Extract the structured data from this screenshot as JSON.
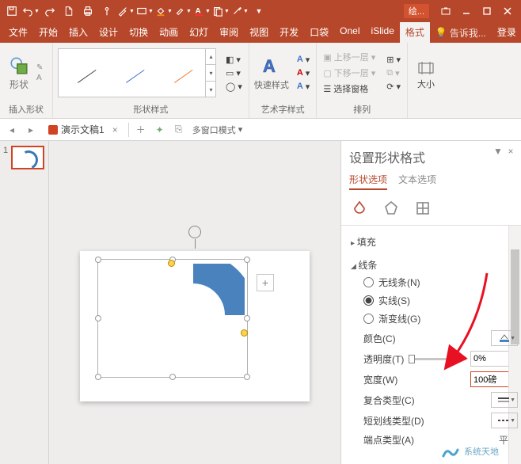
{
  "title_chip": "绘...",
  "tabs": [
    "文件",
    "开始",
    "插入",
    "设计",
    "切换",
    "动画",
    "幻灯",
    "审阅",
    "视图",
    "开发",
    "口袋",
    "Onel",
    "iSlide",
    "格式"
  ],
  "active_tab_index": 13,
  "tell_me": "告诉我...",
  "login": "登录",
  "ribbon": {
    "shapes_label": "插入形状",
    "shapes_btn": "形状",
    "styles_label": "形状样式",
    "wordart_label": "艺术字样式",
    "wordart_btn": "快速样式",
    "arrange_label": "排列",
    "bring_forward": "上移一层",
    "send_backward": "下移一层",
    "selection_pane": "选择窗格",
    "size_label": "大小"
  },
  "doc_tab": "演示文稿1",
  "multi_window": "多窗口模式",
  "thumb_number": "1",
  "plus_sign": "+",
  "pane": {
    "title": "设置形状格式",
    "tab_shape": "形状选项",
    "tab_text": "文本选项",
    "fill_section": "填充",
    "line_section": "线条",
    "no_line": "无线条(N)",
    "solid_line": "实线(S)",
    "gradient_line": "渐变线(G)",
    "color": "颜色(C)",
    "transparency": "透明度(T)",
    "transparency_val": "0%",
    "width": "宽度(W)",
    "width_val": "100磅",
    "compound": "复合类型(C)",
    "dash": "短划线类型(D)",
    "cap": "端点类型(A)",
    "flat": "平面"
  },
  "watermark": "系统天地"
}
